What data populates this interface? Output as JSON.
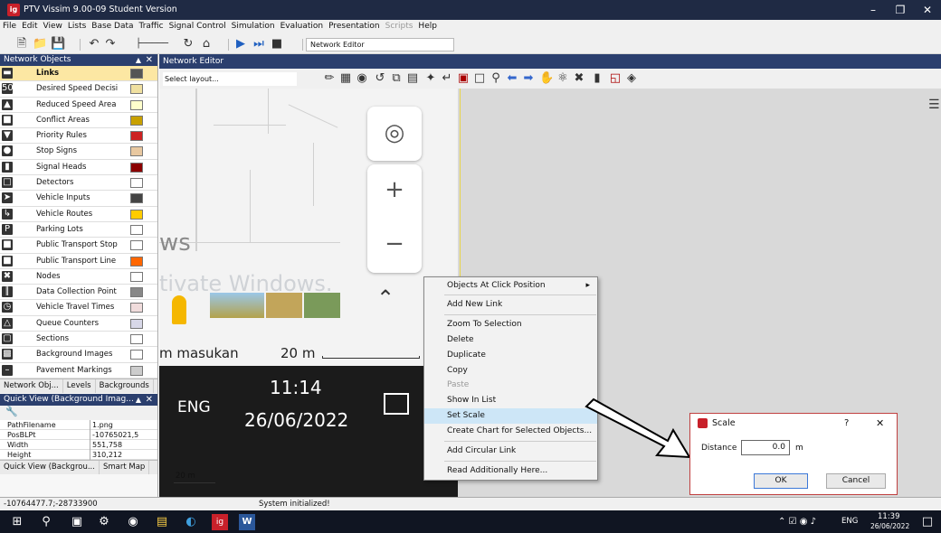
{
  "window": {
    "title": "PTV Vissim 9.00-09 Student Version",
    "app_icon": "ig"
  },
  "menu": [
    "File",
    "Edit",
    "View",
    "Lists",
    "Base Data",
    "Traffic",
    "Signal Control",
    "Simulation",
    "Evaluation",
    "Presentation",
    "Scripts",
    "Help"
  ],
  "toolbar": {
    "editor_select": "Network Editor"
  },
  "network_objects": {
    "title": "Network Objects",
    "items": [
      {
        "label": "Links",
        "icon": "link-icon",
        "color": "#555555",
        "selected": true
      },
      {
        "label": "Desired Speed Decisi",
        "icon": "speed-50-icon",
        "color": "#f0e0a0"
      },
      {
        "label": "Reduced Speed Area",
        "icon": "reduced-speed-icon",
        "color": "#ffffcc"
      },
      {
        "label": "Conflict Areas",
        "icon": "conflict-icon",
        "color": "#c8a000"
      },
      {
        "label": "Priority Rules",
        "icon": "priority-icon",
        "color": "#cc2222"
      },
      {
        "label": "Stop Signs",
        "icon": "stop-sign-icon",
        "color": "#e8c8a0"
      },
      {
        "label": "Signal Heads",
        "icon": "signal-head-icon",
        "color": "#8b0000"
      },
      {
        "label": "Detectors",
        "icon": "detector-icon",
        "color": "#ffffff"
      },
      {
        "label": "Vehicle Inputs",
        "icon": "vehicle-input-icon",
        "color": "#444444"
      },
      {
        "label": "Vehicle Routes",
        "icon": "vehicle-route-icon",
        "color": "#ffcc00"
      },
      {
        "label": "Parking Lots",
        "icon": "parking-icon",
        "color": "#ffffff"
      },
      {
        "label": "Public Transport Stop",
        "icon": "pt-stop-icon",
        "color": "#ffffff"
      },
      {
        "label": "Public Transport Line",
        "icon": "pt-line-icon",
        "color": "#ff6600"
      },
      {
        "label": "Nodes",
        "icon": "node-icon",
        "color": "#ffffff"
      },
      {
        "label": "Data Collection Point",
        "icon": "data-collection-icon",
        "color": "#888888"
      },
      {
        "label": "Vehicle Travel Times",
        "icon": "travel-time-icon",
        "color": "#f0dcdc"
      },
      {
        "label": "Queue Counters",
        "icon": "queue-counter-icon",
        "color": "#d8d8e8"
      },
      {
        "label": "Sections",
        "icon": "section-icon",
        "color": "#ffffff"
      },
      {
        "label": "Background Images",
        "icon": "background-image-icon",
        "color": "#ffffff"
      },
      {
        "label": "Pavement Markings",
        "icon": "pavement-marking-icon",
        "color": "#cccccc"
      }
    ],
    "tabs": [
      "Network Obj...",
      "Levels",
      "Backgrounds"
    ]
  },
  "quick_view": {
    "title": "Quick View (Background Imag...",
    "rows": [
      {
        "key": "PathFilename",
        "value": "1.png"
      },
      {
        "key": "PosBLPt",
        "value": "-10765021,5"
      },
      {
        "key": "Width",
        "value": "551,758"
      },
      {
        "key": "Height",
        "value": "310,212"
      }
    ],
    "tabs": [
      "Quick View (Backgrou...",
      "Smart Map"
    ]
  },
  "network_editor": {
    "title": "Network Editor",
    "layout_select": "Select layout...",
    "scale_label": "20 m",
    "map_texts": {
      "ws": "ws",
      "activate": "tivate Windows.",
      "masukan": "m masukan",
      "scale": "20 m"
    }
  },
  "embedded_taskbar": {
    "lang": "ENG",
    "time": "11:14",
    "date": "26/06/2022"
  },
  "context_menu": [
    {
      "label": "Objects At Click Position",
      "submenu": true
    },
    {
      "label": "Add New Link"
    },
    {
      "label": "Zoom To Selection"
    },
    {
      "label": "Delete"
    },
    {
      "label": "Duplicate"
    },
    {
      "label": "Copy"
    },
    {
      "label": "Paste",
      "disabled": true
    },
    {
      "label": "Show In List"
    },
    {
      "label": "Set Scale",
      "highlighted": true
    },
    {
      "label": "Create Chart for Selected Objects..."
    },
    {
      "label": "Add Circular Link"
    },
    {
      "label": "Read Additionally Here..."
    }
  ],
  "scale_dialog": {
    "title": "Scale",
    "help": "?",
    "close": "✕",
    "distance_label": "Distance",
    "distance_value": "0.0",
    "unit": "m",
    "ok": "OK",
    "cancel": "Cancel"
  },
  "status": {
    "coords": "-10764477.7;-28733900",
    "message": "System initialized!"
  },
  "taskbar": {
    "lang": "ENG",
    "time": "11:39",
    "date": "26/06/2022"
  }
}
